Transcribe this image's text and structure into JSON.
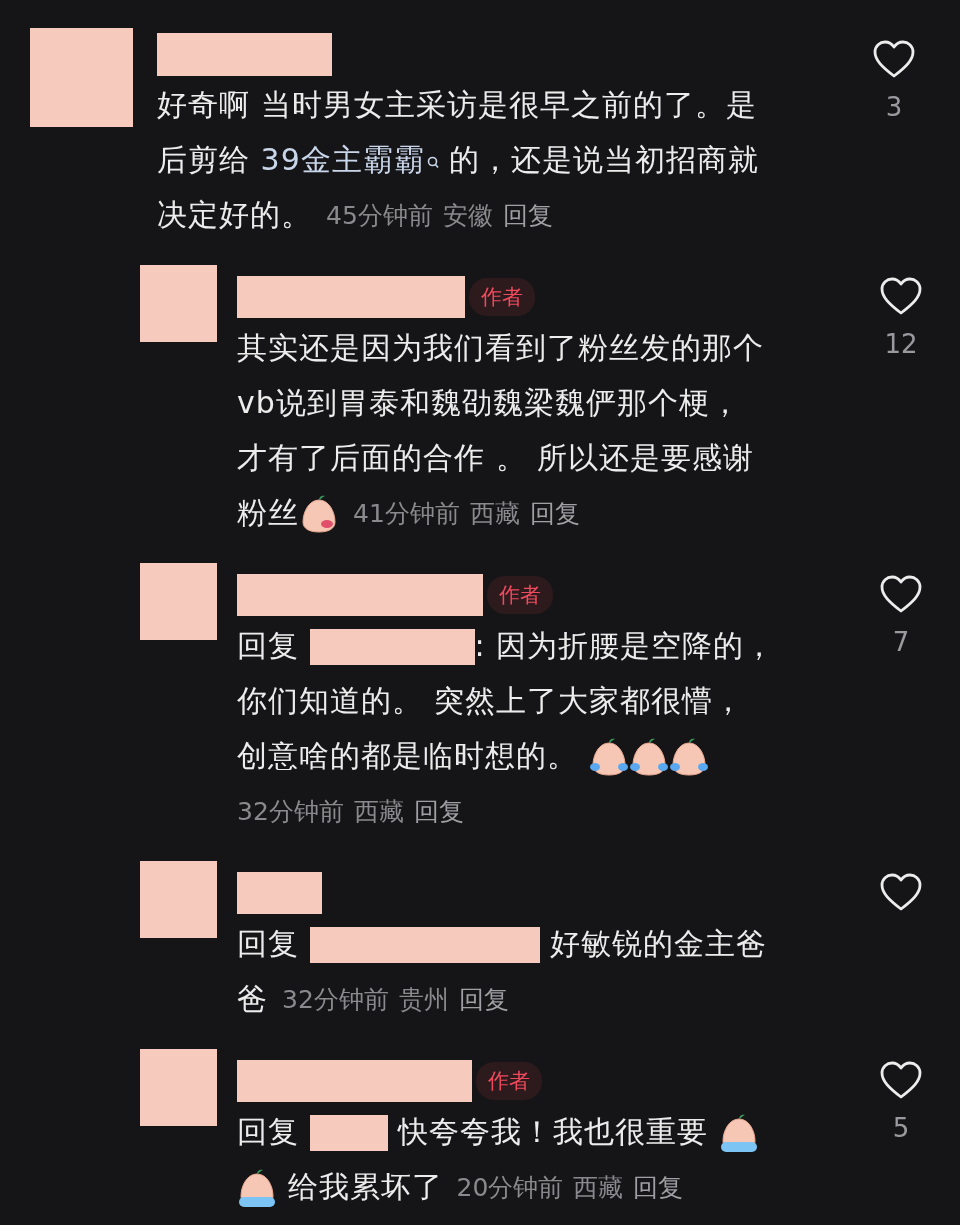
{
  "comments": [
    {
      "lines": [
        [
          {
            "kind": "text",
            "text": "好奇啊 当时男女主采访是很早之前的了。是"
          }
        ],
        [
          {
            "kind": "text",
            "text": "后剪给 "
          },
          {
            "kind": "link",
            "text": "39金主霸霸"
          },
          {
            "kind": "text",
            "text": " 的，还是说当初招商就"
          }
        ],
        [
          {
            "kind": "text",
            "text": "决定好的。"
          },
          {
            "kind": "time",
            "text": "45分钟前"
          },
          {
            "kind": "location",
            "text": "安徽"
          },
          {
            "kind": "reply",
            "text": "回复"
          }
        ]
      ],
      "likes": "3",
      "replies": [
        {
          "badge": "作者",
          "lines": [
            [
              {
                "kind": "text",
                "text": "其实还是因为我们看到了粉丝发的那个"
              }
            ],
            [
              {
                "kind": "text",
                "text": "vb说到胃泰和魏劭魏梁魏俨那个梗，"
              }
            ],
            [
              {
                "kind": "text",
                "text": "才有了后面的合作 。 所以还是要感谢"
              }
            ],
            [
              {
                "kind": "text",
                "text": "粉丝"
              },
              {
                "kind": "kiss"
              },
              {
                "kind": "time",
                "text": "41分钟前"
              },
              {
                "kind": "location",
                "text": "西藏"
              },
              {
                "kind": "reply",
                "text": "回复"
              }
            ]
          ],
          "likes": "12"
        },
        {
          "badge": "作者",
          "lines": [
            [
              {
                "kind": "text",
                "text": "回复 "
              },
              {
                "kind": "redacted"
              },
              {
                "kind": "text",
                "text": ": 因为折腰是空降的，"
              }
            ],
            [
              {
                "kind": "text",
                "text": "你们知道的。 突然上了大家都很懵，"
              }
            ],
            [
              {
                "kind": "text",
                "text": "创意啥的都是临时想的。 "
              },
              {
                "kind": "laughcry"
              },
              {
                "kind": "laughcry"
              },
              {
                "kind": "laughcry"
              }
            ],
            [
              {
                "kind": "time",
                "text": "32分钟前"
              },
              {
                "kind": "location",
                "text": "西藏"
              },
              {
                "kind": "reply",
                "text": "回复"
              }
            ]
          ],
          "likes": "7"
        },
        {
          "lines": [
            [
              {
                "kind": "text",
                "text": "回复 "
              },
              {
                "kind": "redacted"
              },
              {
                "kind": "text",
                "text": " 好敏锐的金主爸"
              }
            ],
            [
              {
                "kind": "text",
                "text": "爸"
              },
              {
                "kind": "time",
                "text": "32分钟前"
              },
              {
                "kind": "location",
                "text": "贵州"
              },
              {
                "kind": "reply",
                "text": "回复"
              }
            ]
          ]
        },
        {
          "badge": "作者",
          "lines": [
            [
              {
                "kind": "text",
                "text": "回复 "
              },
              {
                "kind": "redacted"
              },
              {
                "kind": "text",
                "text": " 快夸夸我！我也很重要 "
              },
              {
                "kind": "sob"
              }
            ],
            [
              {
                "kind": "sob"
              },
              {
                "kind": "text",
                "text": " 给我累坏了"
              },
              {
                "kind": "time",
                "text": "20分钟前"
              },
              {
                "kind": "location",
                "text": "西藏"
              },
              {
                "kind": "reply",
                "text": "回复"
              }
            ]
          ],
          "likes": "5"
        }
      ]
    }
  ]
}
